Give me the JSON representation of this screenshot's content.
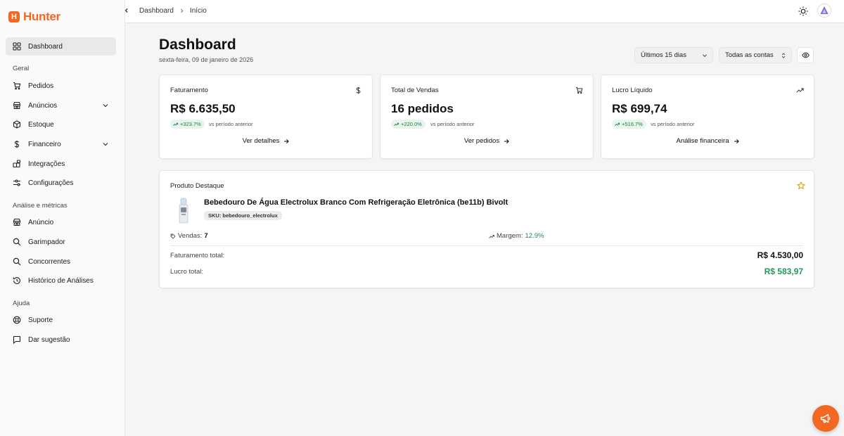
{
  "brand": {
    "name": "Hunter",
    "mark": "H",
    "color": "#f26722"
  },
  "sidebar": {
    "items": [
      {
        "label": "Dashboard",
        "icon": "grid-icon",
        "active": true
      },
      {
        "label": "Pedidos",
        "icon": "cart-icon"
      },
      {
        "label": "Anúncios",
        "icon": "store-icon",
        "expandable": true
      },
      {
        "label": "Estoque",
        "icon": "box-icon"
      },
      {
        "label": "Financeiro",
        "icon": "dollar-icon",
        "expandable": true
      },
      {
        "label": "Integrações",
        "icon": "puzzle-icon"
      },
      {
        "label": "Configurações",
        "icon": "sliders-icon"
      },
      {
        "label": "Anúncio",
        "icon": "store-icon"
      },
      {
        "label": "Garimpador",
        "icon": "search-icon"
      },
      {
        "label": "Concorrentes",
        "icon": "search-icon"
      },
      {
        "label": "Histórico de Análises",
        "icon": "history-icon"
      },
      {
        "label": "Suporte",
        "icon": "lifebuoy-icon"
      },
      {
        "label": "Dar sugestão",
        "icon": "message-icon"
      }
    ],
    "sections": [
      "Geral",
      "Análise e métricas",
      "Ajuda"
    ]
  },
  "topbar": {
    "breadcrumb": [
      "Dashboard",
      "Início"
    ]
  },
  "header": {
    "title": "Dashboard",
    "date": "sexta-feira, 09 de janeiro de 2026",
    "period_select": "Últimos 15 dias",
    "account_select": "Todas as contas"
  },
  "cards": [
    {
      "label": "Faturamento",
      "icon": "dollar-icon",
      "value": "R$ 6.635,50",
      "change": "+323.7%",
      "compare": "vs período anterior",
      "link": "Ver detalhes"
    },
    {
      "label": "Total de Vendas",
      "icon": "cart-icon",
      "value": "16 pedidos",
      "change": "+220.0%",
      "compare": "vs período anterior",
      "link": "Ver pedidos"
    },
    {
      "label": "Lucro Líquido",
      "icon": "trending-up-icon",
      "value": "R$ 699,74",
      "change": "+516.7%",
      "compare": "vs período anterior",
      "link": "Análise financeira"
    }
  ],
  "featured": {
    "label": "Produto Destaque",
    "product_name": "Bebedouro De Água Electrolux Branco Com Refrigeração Eletrônica (be11b) Bivolt",
    "sku": "SKU: bebedouro_electrolux",
    "sales_label": "Vendas:",
    "sales_value": "7",
    "margin_label": "Margem:",
    "margin_value": "12.9%",
    "revenue_label": "Faturamento total:",
    "revenue_value": "R$ 4.530,00",
    "profit_label": "Lucro total:",
    "profit_value": "R$ 583,97"
  },
  "colors": {
    "accent": "#f26722",
    "positive": "#22995a",
    "badge_bg": "#e7f5ec"
  }
}
